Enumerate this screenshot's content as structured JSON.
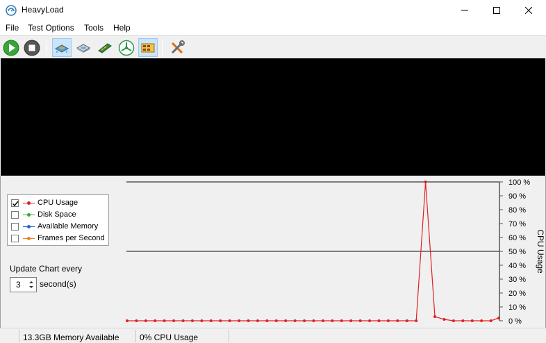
{
  "window": {
    "title": "HeavyLoad"
  },
  "menu": [
    {
      "label": "File"
    },
    {
      "label": "Test Options"
    },
    {
      "label": "Tools"
    },
    {
      "label": "Help"
    }
  ],
  "legend": [
    {
      "label": "CPU Usage",
      "checked": true,
      "color": "#e02020"
    },
    {
      "label": "Disk Space",
      "checked": false,
      "color": "#33aa33"
    },
    {
      "label": "Available Memory",
      "checked": false,
      "color": "#2266cc"
    },
    {
      "label": "Frames per Second",
      "checked": false,
      "color": "#f08020"
    }
  ],
  "update": {
    "label": "Update Chart every",
    "value": "3",
    "unit": "second(s)"
  },
  "status": {
    "memory": "13.3GB Memory Available",
    "cpu": "0% CPU Usage"
  },
  "chart_data": {
    "type": "line",
    "ylabel": "CPU Usage",
    "ylim": [
      0,
      100
    ],
    "yticks": [
      "100 %",
      "90 %",
      "80 %",
      "70 %",
      "60 %",
      "50 %",
      "40 %",
      "30 %",
      "20 %",
      "10 %",
      "0 %"
    ],
    "grid": "lines at 50% and 100%",
    "series": [
      {
        "name": "CPU Usage",
        "color": "#e02020",
        "values": [
          0,
          0,
          0,
          0,
          0,
          0,
          0,
          0,
          0,
          0,
          0,
          0,
          0,
          0,
          0,
          0,
          0,
          0,
          0,
          0,
          0,
          0,
          0,
          0,
          0,
          0,
          0,
          0,
          0,
          0,
          0,
          0,
          100,
          3,
          1,
          0,
          0,
          0,
          0,
          0,
          2
        ]
      }
    ]
  }
}
